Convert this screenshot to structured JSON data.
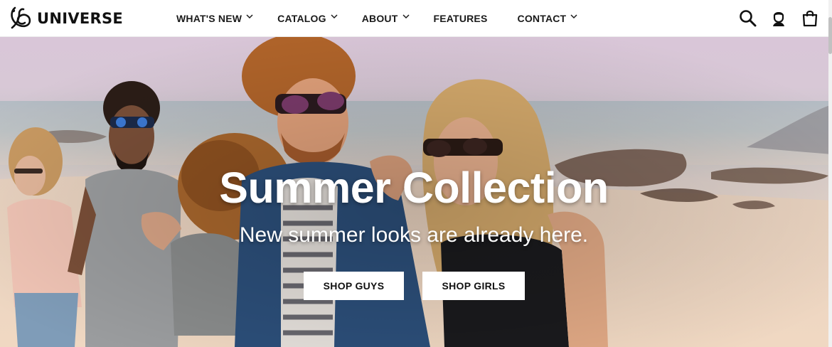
{
  "header": {
    "brand": "UNIVERSE",
    "nav": [
      {
        "label": "WHAT'S NEW",
        "has_dropdown": true
      },
      {
        "label": "CATALOG",
        "has_dropdown": true
      },
      {
        "label": "ABOUT",
        "has_dropdown": true
      },
      {
        "label": "FEATURES",
        "has_dropdown": false
      },
      {
        "label": "CONTACT",
        "has_dropdown": true
      }
    ],
    "icons": [
      "search-icon",
      "account-icon",
      "shopping-bag-icon"
    ]
  },
  "hero": {
    "title": "Summer Collection",
    "subtitle": "New summer looks are already here.",
    "buttons": {
      "guys": "SHOP GUYS",
      "girls": "SHOP GIRLS"
    }
  },
  "colors": {
    "text_dark": "#111111",
    "button_bg": "#ffffff",
    "hero_text": "#ffffff"
  }
}
